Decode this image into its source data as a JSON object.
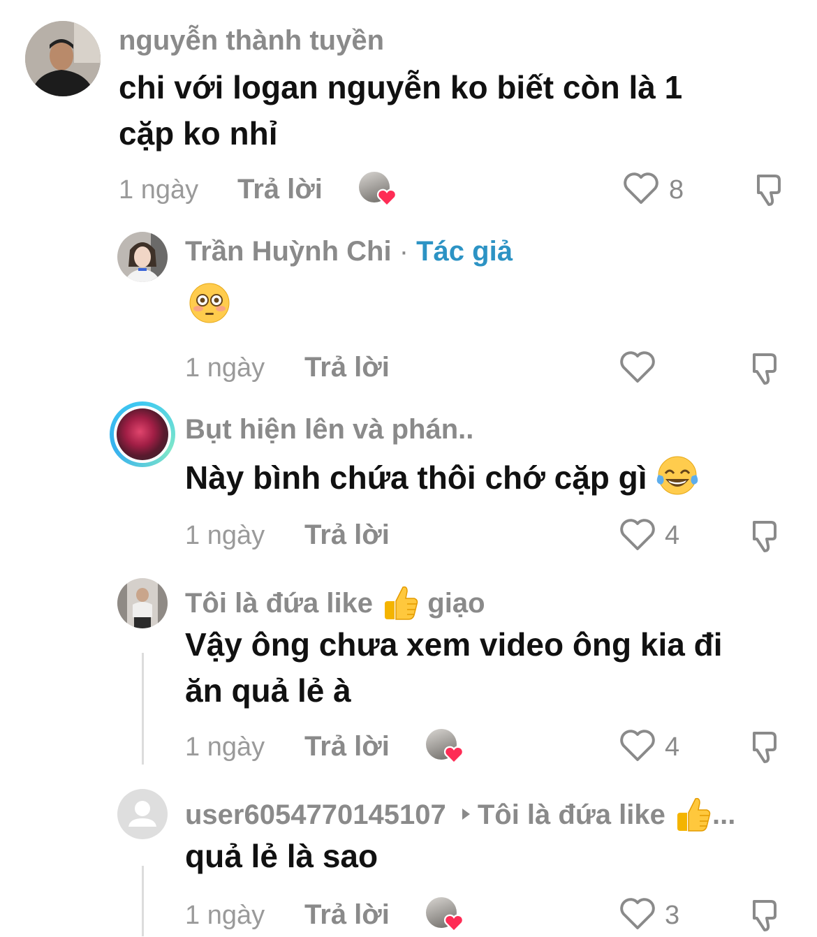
{
  "comments": [
    {
      "username": "nguyễn thành tuyền",
      "text_line1": "chi với logan nguyễn ko biết còn là 1",
      "text_line2": "cặp ko nhỉ",
      "time": "1 ngày",
      "reply_label": "Trả lời",
      "likes": "8",
      "author_liked": true
    },
    {
      "username": "Trần Huỳnh Chi",
      "separator": " · ",
      "author_tag": "Tác giả",
      "time": "1 ngày",
      "reply_label": "Trả lời",
      "likes": ""
    },
    {
      "username": "Bụt hiện lên và phán..",
      "text": "Này bình chứa thôi chớ cặp gì",
      "time": "1 ngày",
      "reply_label": "Trả lời",
      "likes": "4"
    },
    {
      "username_part1": "Tôi là đứa like",
      "username_part2": "giạo",
      "text_line1": "Vậy ông chưa xem video ông kia đi",
      "text_line2": "ăn quả lẻ à",
      "time": "1 ngày",
      "reply_label": "Trả lời",
      "likes": "4",
      "author_liked": true
    },
    {
      "username": "user6054770145107",
      "reply_to": "Tôi là đứa like",
      "ellipsis": "...",
      "text": "quả lẻ là sao",
      "time": "1 ngày",
      "reply_label": "Trả lời",
      "likes": "3",
      "author_liked": true
    }
  ],
  "icons": {
    "like": "heart-outline-icon",
    "dislike": "thumbs-down-outline-icon",
    "author_like": "author-liked-heart-badge",
    "thumbs_up": "thumbs-up-emoji",
    "flushed": "flushed-face-emoji",
    "laughing": "tears-of-joy-emoji",
    "reply_arrow": "caret-right-icon"
  },
  "colors": {
    "author_tag": "#2c93c4",
    "heart_badge": "#fe2c55",
    "muted_text": "#8a8a8a"
  }
}
